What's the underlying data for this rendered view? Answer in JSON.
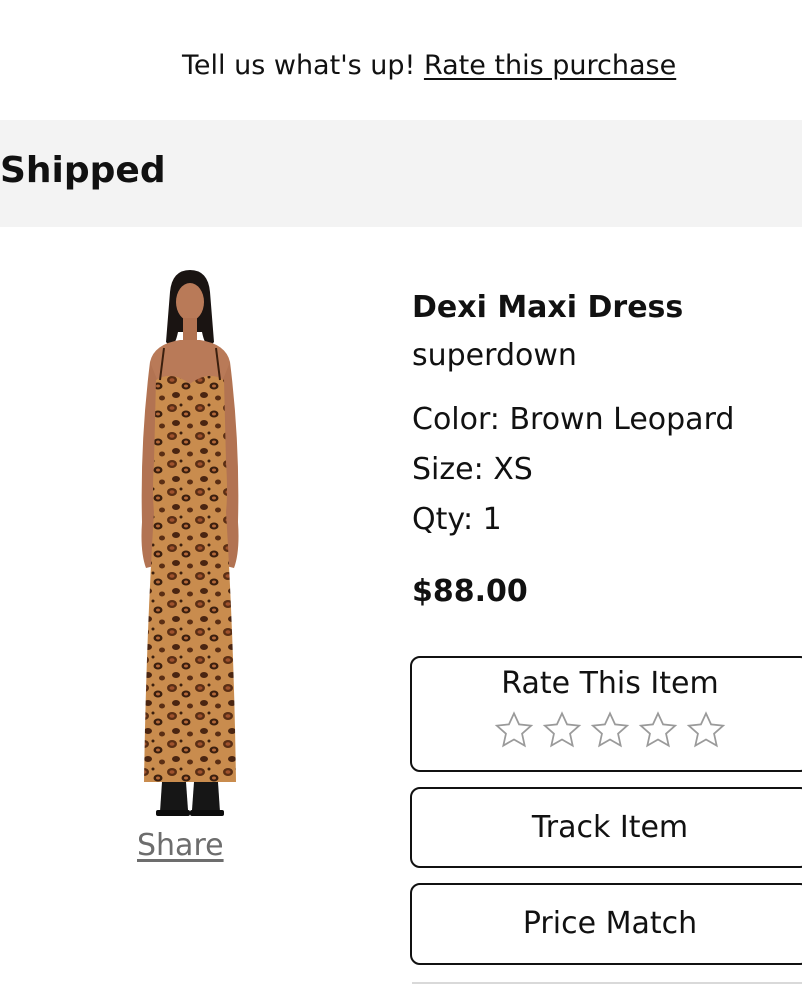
{
  "feedback": {
    "prompt": "Tell us what's up!",
    "link": "Rate this purchase"
  },
  "order": {
    "status": "Shipped"
  },
  "item": {
    "name": "Dexi Maxi Dress",
    "brand": "superdown",
    "color": "Color: Brown Leopard",
    "size": "Size: XS",
    "qty": "Qty: 1",
    "price": "$88.00",
    "share_label": "Share"
  },
  "actions": {
    "rate_label": "Rate This Item",
    "rating": 0,
    "rating_max": 5,
    "track_label": "Track Item",
    "price_match_label": "Price Match"
  },
  "colors": {
    "status_bar": "#f3f3f3",
    "text": "#111111",
    "share": "#6d6d6d",
    "star_outline": "#9a9a9a"
  },
  "icons": {
    "star": "star-outline-icon"
  }
}
